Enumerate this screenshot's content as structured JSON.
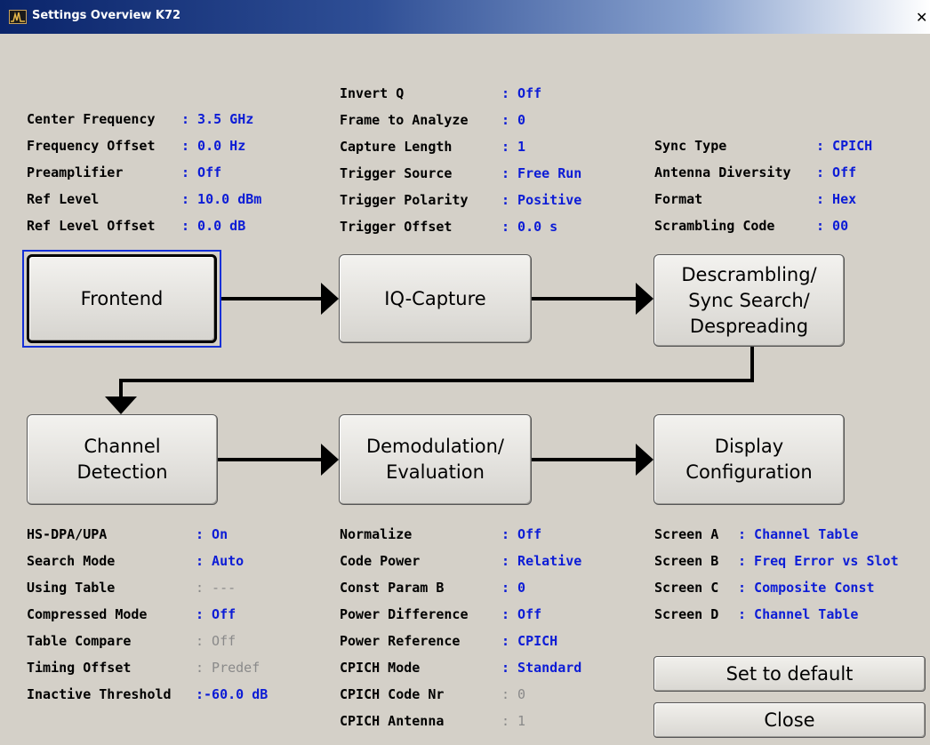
{
  "window": {
    "title": "Settings Overview K72",
    "close_glyph": "✕",
    "app_icon": "spectrum-icon"
  },
  "colors": {
    "value": "#0c1cd6",
    "disabled_value": "#8a8a8a",
    "focus_ring": "#1430d8",
    "background": "#d4d0c8",
    "title_bar": "#0a246a"
  },
  "frontend_settings": [
    {
      "label": "Center Frequency",
      "value": ": 3.5 GHz"
    },
    {
      "label": "Frequency Offset",
      "value": ": 0.0 Hz"
    },
    {
      "label": "Preamplifier",
      "value": ": Off"
    },
    {
      "label": "Ref Level",
      "value": ": 10.0 dBm"
    },
    {
      "label": "Ref Level Offset",
      "value": ": 0.0 dB"
    }
  ],
  "capture_settings": [
    {
      "label": "Invert Q",
      "value": ": Off"
    },
    {
      "label": "Frame to Analyze",
      "value": ": 0"
    },
    {
      "label": "Capture Length",
      "value": ": 1"
    },
    {
      "label": "Trigger Source",
      "value": ": Free Run"
    },
    {
      "label": "Trigger Polarity",
      "value": ": Positive"
    },
    {
      "label": "Trigger Offset",
      "value": ": 0.0 s"
    }
  ],
  "sync_settings": [
    {
      "label": "Sync Type",
      "value": ": CPICH"
    },
    {
      "label": "Antenna Diversity",
      "value": ": Off"
    },
    {
      "label": "Format",
      "value": ": Hex"
    },
    {
      "label": "Scrambling Code",
      "value": ": 00"
    }
  ],
  "blocks": {
    "frontend": "Frontend",
    "iq_capture": "IQ-Capture",
    "descrambling": "Descrambling/\nSync Search/\nDespreading",
    "channel_detection": "Channel\nDetection",
    "demodulation": "Demodulation/\nEvaluation",
    "display_config": "Display\nConfiguration"
  },
  "channel_settings": [
    {
      "label": "HS-DPA/UPA",
      "value": ": On",
      "enabled": true
    },
    {
      "label": "Search Mode",
      "value": ": Auto",
      "enabled": true
    },
    {
      "label": "Using Table",
      "value": ": ---",
      "enabled": false
    },
    {
      "label": "Compressed Mode",
      "value": ": Off",
      "enabled": true
    },
    {
      "label": "Table Compare",
      "value": ": Off",
      "enabled": false
    },
    {
      "label": "Timing Offset",
      "value": ": Predef",
      "enabled": false
    },
    {
      "label": "Inactive Threshold",
      "value": ":-60.0 dB",
      "enabled": true
    }
  ],
  "demod_settings": [
    {
      "label": "Normalize",
      "value": ": Off",
      "enabled": true
    },
    {
      "label": "Code Power",
      "value": ": Relative",
      "enabled": true
    },
    {
      "label": "Const Param B",
      "value": ": 0",
      "enabled": true
    },
    {
      "label": "Power Difference",
      "value": ": Off",
      "enabled": true
    },
    {
      "label": "Power Reference",
      "value": ": CPICH",
      "enabled": true
    },
    {
      "label": "CPICH Mode",
      "value": ": Standard",
      "enabled": true
    },
    {
      "label": "CPICH Code Nr",
      "value": ": 0",
      "enabled": false
    },
    {
      "label": "CPICH Antenna",
      "value": ": 1",
      "enabled": false
    }
  ],
  "screen_settings": [
    {
      "label": "Screen A",
      "value": ": Channel Table"
    },
    {
      "label": "Screen B",
      "value": ": Freq Error vs Slot"
    },
    {
      "label": "Screen C",
      "value": ": Composite Const"
    },
    {
      "label": "Screen D",
      "value": ": Channel Table"
    }
  ],
  "buttons": {
    "set_default": "Set to default",
    "close": "Close"
  }
}
